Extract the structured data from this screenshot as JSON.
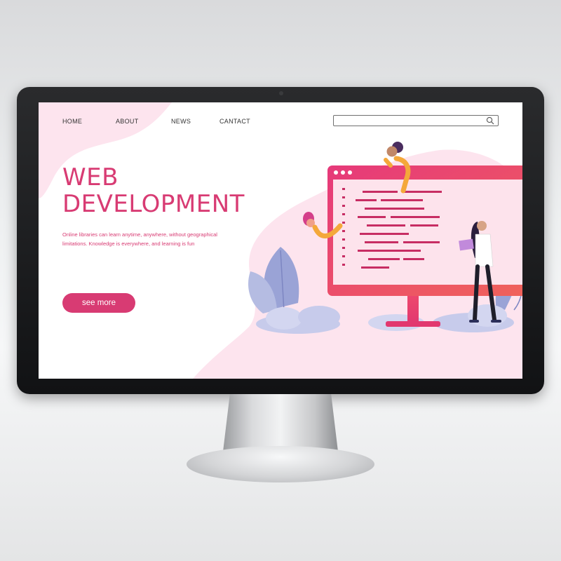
{
  "nav": {
    "items": [
      {
        "label": "HOME"
      },
      {
        "label": "ABOUT"
      },
      {
        "label": "NEWS"
      },
      {
        "label": "CANTACT"
      }
    ]
  },
  "search": {
    "placeholder": ""
  },
  "hero": {
    "title_line1": "WEB",
    "title_line2": "DEVELOPMENT",
    "desc_line1": "Online libraries can learn anytime, anywhere, without geographical",
    "desc_line2": "limitations.  Knowledge is everywhere, and learning is fun",
    "button_label": "see more"
  },
  "colors": {
    "accent": "#d83b73",
    "blob": "#fde4ee",
    "monitor_frame": "#e9486f",
    "code_lines": "#c72d63",
    "leaves": "#9aa3d6"
  }
}
